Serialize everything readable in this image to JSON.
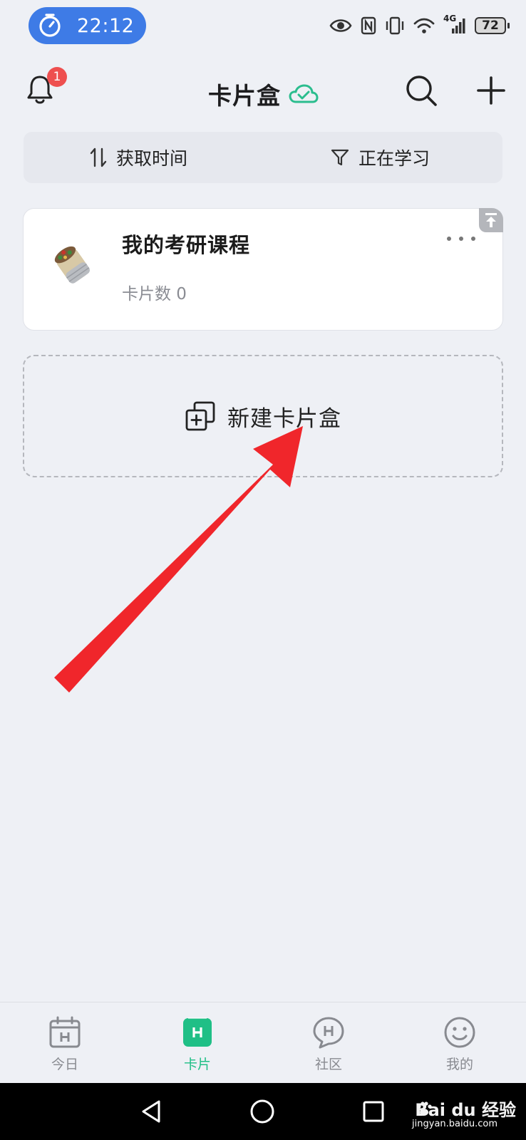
{
  "status_bar": {
    "time": "22:12",
    "network": "4G",
    "battery": "72"
  },
  "header": {
    "title": "卡片盒",
    "notification_count": "1"
  },
  "filter_bar": {
    "sort_label": "获取时间",
    "filter_label": "正在学习"
  },
  "decks": [
    {
      "name": "我的考研课程",
      "count_text": "卡片数 0"
    }
  ],
  "new_deck_label": "新建卡片盒",
  "tabs": [
    {
      "label": "今日",
      "active": false
    },
    {
      "label": "卡片",
      "active": true
    },
    {
      "label": "社区",
      "active": false
    },
    {
      "label": "我的",
      "active": false
    }
  ],
  "watermark": {
    "brand": "Bai du 经验",
    "url": "jingyan.baidu.com"
  },
  "colors": {
    "accent": "#1fbf86",
    "time_pill": "#3e7be6",
    "badge": "#ee4f4f",
    "annotation_arrow": "#f0262b",
    "background": "#eef0f5"
  }
}
